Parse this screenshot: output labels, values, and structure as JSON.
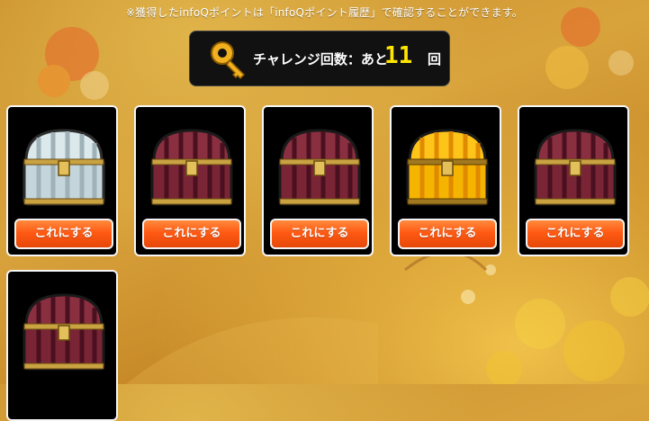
{
  "notice": "※獲得したinfoQポイントは「infoQポイント履歴」で確認することができます。",
  "challenge": {
    "label": "チャレンジ回数：あと",
    "count": "11",
    "unit": "回",
    "key_icon": "key-icon"
  },
  "chests": [
    {
      "type": "silver-chest",
      "button": "これにする"
    },
    {
      "type": "maroon-chest",
      "button": "これにする"
    },
    {
      "type": "maroon-chest",
      "button": "これにする"
    },
    {
      "type": "gold-chest",
      "button": "これにする"
    },
    {
      "type": "maroon-chest",
      "button": "これにする"
    },
    {
      "type": "maroon-chest",
      "button": ""
    }
  ],
  "colors": {
    "background": "#d09a34",
    "button": "#ff5a14",
    "count": "#ffe600",
    "maroon_chest": "#6b1e2e",
    "silver_chest": "#cfdfe4",
    "gold_chest": "#f5b400"
  }
}
